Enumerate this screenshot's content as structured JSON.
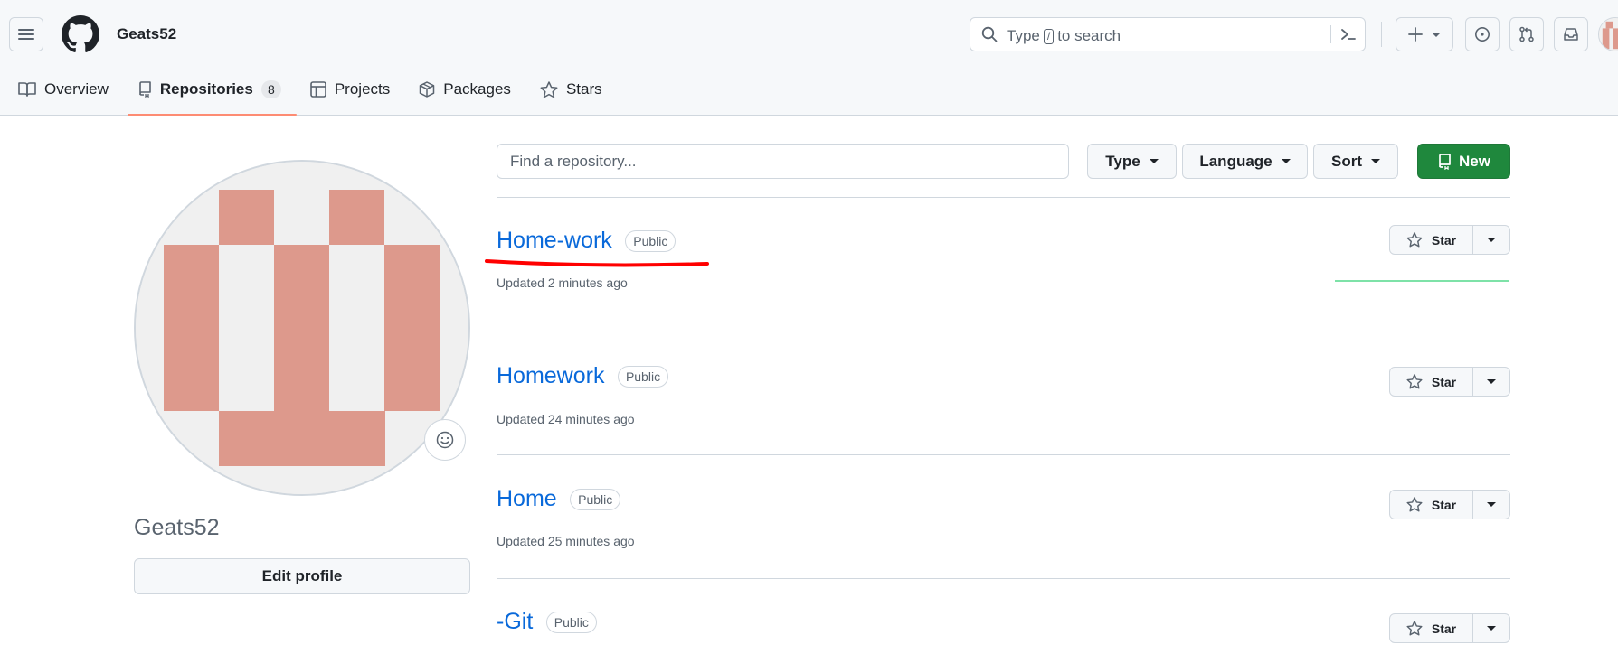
{
  "header": {
    "username": "Geats52",
    "search": {
      "prefix": "Type",
      "key": "/",
      "suffix": "to search"
    }
  },
  "tabs": [
    {
      "label": "Overview"
    },
    {
      "label": "Repositories",
      "count": "8"
    },
    {
      "label": "Projects"
    },
    {
      "label": "Packages"
    },
    {
      "label": "Stars"
    }
  ],
  "profile": {
    "name": "Geats52",
    "edit_label": "Edit profile"
  },
  "filters": {
    "search_placeholder": "Find a repository...",
    "type_label": "Type",
    "language_label": "Language",
    "sort_label": "Sort",
    "new_label": "New"
  },
  "repos": [
    {
      "name": "Home-work",
      "visibility": "Public",
      "updated": "Updated 2 minutes ago",
      "star_label": "Star"
    },
    {
      "name": "Homework",
      "visibility": "Public",
      "updated": "Updated 24 minutes ago",
      "star_label": "Star"
    },
    {
      "name": "Home",
      "visibility": "Public",
      "updated": "Updated 25 minutes ago",
      "star_label": "Star"
    },
    {
      "name": "-Git",
      "visibility": "Public",
      "updated": "",
      "star_label": "Star"
    }
  ],
  "colors": {
    "accent_blue": "#0969da",
    "new_green": "#1f883d",
    "active_tab_underline": "#fd8c73",
    "avatar_salmon": "#dd998c",
    "annotation_red": "#ff0000"
  }
}
